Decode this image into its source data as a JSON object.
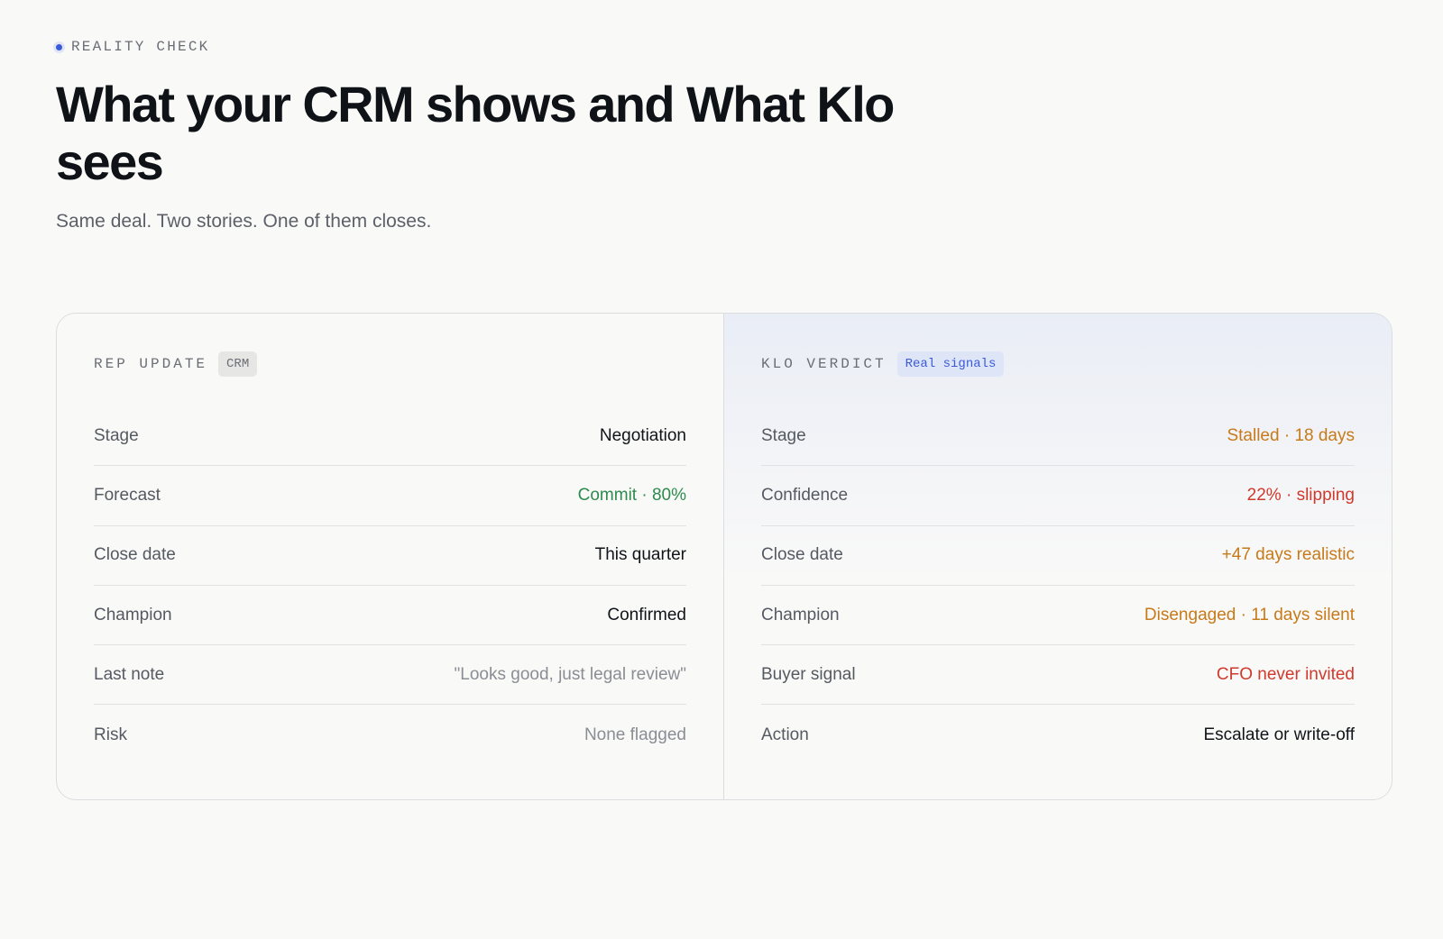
{
  "header": {
    "eyebrow": "REALITY CHECK",
    "title": "What your CRM shows and What Klo sees",
    "subtitle": "Same deal. Two stories. One of them closes."
  },
  "colors": {
    "accent": "#3a5bd9",
    "positive": "#2e8b4e",
    "warning": "#c77a1a",
    "danger": "#cf3a2d",
    "muted": "#8a8d93",
    "strong": "#111418"
  },
  "left": {
    "label": "REP UPDATE",
    "tag": "CRM",
    "rows": [
      {
        "label": "Stage",
        "value": "Negotiation",
        "tone": "strong"
      },
      {
        "label": "Forecast",
        "value": "Commit · 80%",
        "tone": "positive"
      },
      {
        "label": "Close date",
        "value": "This quarter",
        "tone": "strong"
      },
      {
        "label": "Champion",
        "value": "Confirmed",
        "tone": "strong"
      },
      {
        "label": "Last note",
        "value": "\"Looks good, just legal review\"",
        "tone": "muted"
      },
      {
        "label": "Risk",
        "value": "None flagged",
        "tone": "muted"
      }
    ]
  },
  "right": {
    "label": "KLO VERDICT",
    "tag": "Real signals",
    "rows": [
      {
        "label": "Stage",
        "value": "Stalled · 18 days",
        "tone": "warning"
      },
      {
        "label": "Confidence",
        "value": "22% · slipping",
        "tone": "danger"
      },
      {
        "label": "Close date",
        "value": "+47 days realistic",
        "tone": "warning"
      },
      {
        "label": "Champion",
        "value": "Disengaged · 11 days silent",
        "tone": "warning"
      },
      {
        "label": "Buyer signal",
        "value": "CFO never invited",
        "tone": "danger"
      },
      {
        "label": "Action",
        "value": "Escalate or write-off",
        "tone": "strong"
      }
    ]
  }
}
